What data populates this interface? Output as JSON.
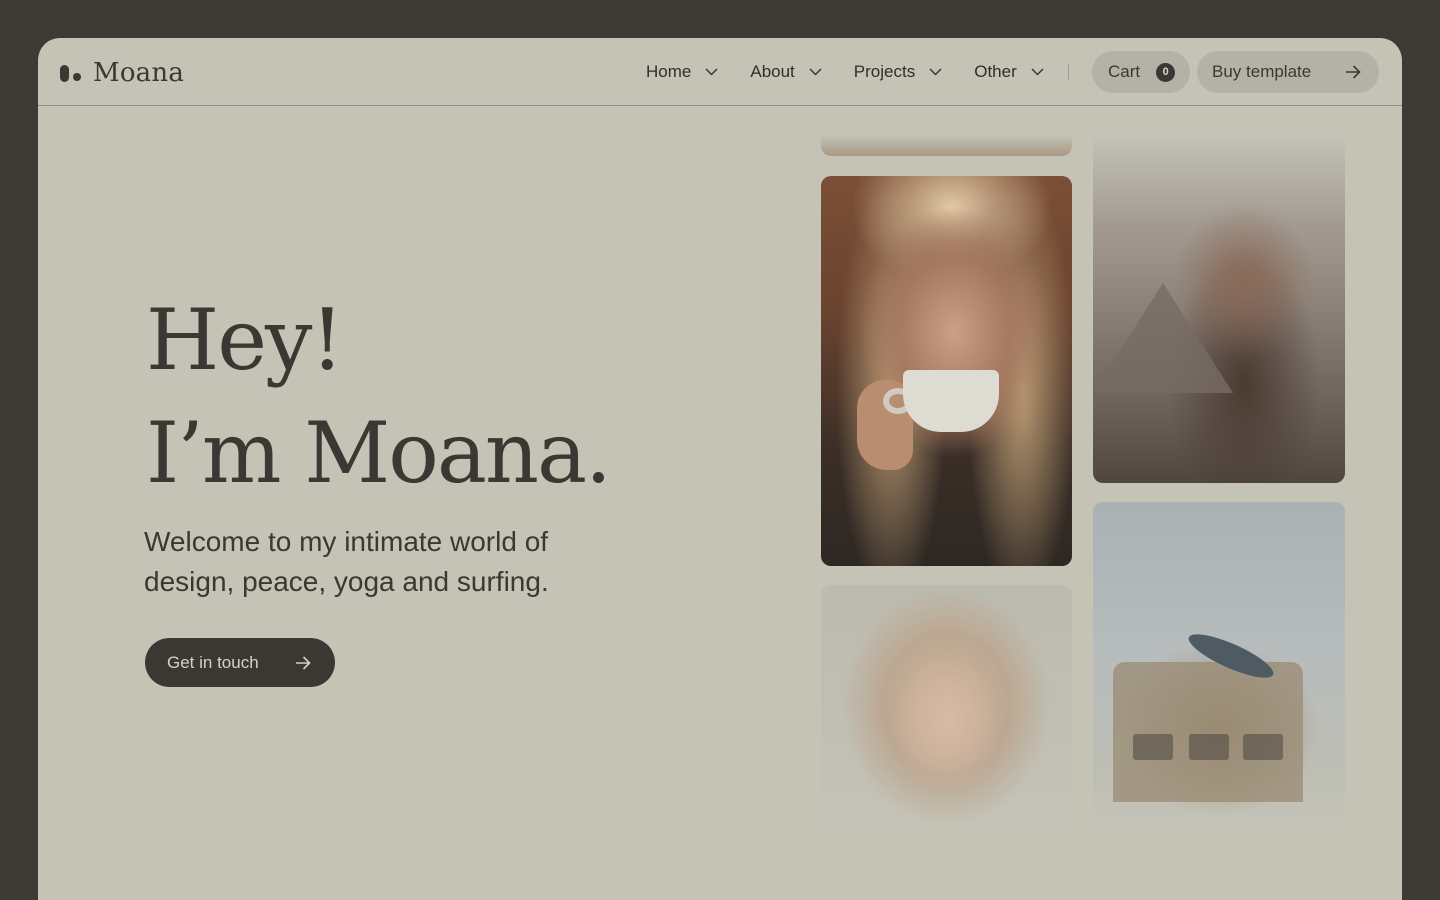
{
  "brand": {
    "name": "Moana"
  },
  "nav": {
    "items": [
      {
        "label": "Home"
      },
      {
        "label": "About"
      },
      {
        "label": "Projects"
      },
      {
        "label": "Other"
      }
    ]
  },
  "cart": {
    "label": "Cart",
    "count": "0"
  },
  "buy": {
    "label": "Buy template"
  },
  "hero": {
    "title_line1": "Hey!",
    "title_line2": "I’m Moana.",
    "subtitle": "Welcome to my intimate world of design, peace, yoga and surfing.",
    "cta_label": "Get in touch"
  },
  "colors": {
    "background": "#c4c3b6",
    "outer": "#3b3a33",
    "text": "#3a3833",
    "button": "#3a3833"
  },
  "icons": [
    "logo-mark-icon",
    "chevron-down-icon",
    "arrow-right-icon"
  ]
}
